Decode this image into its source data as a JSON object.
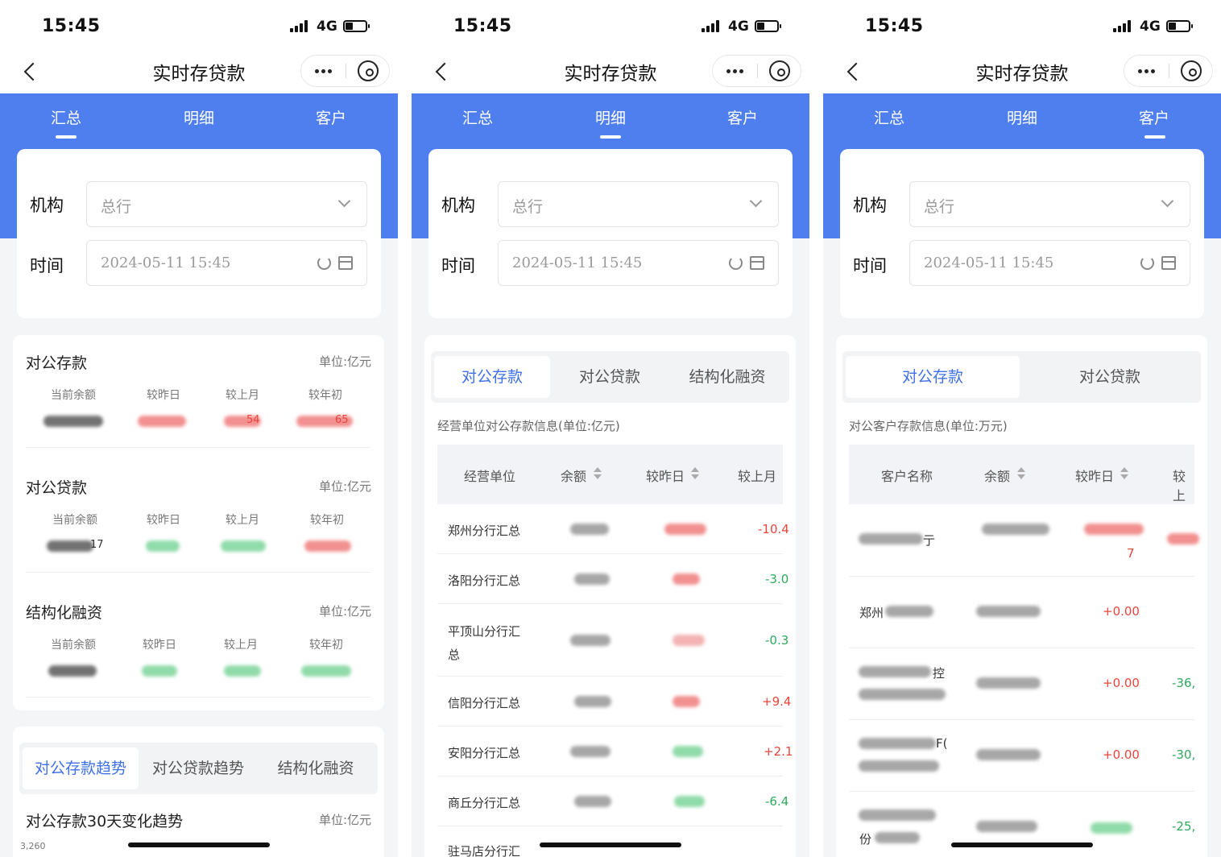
{
  "status": {
    "time": "15:45",
    "network": "4G"
  },
  "nav": {
    "title": "实时存贷款"
  },
  "tabs": [
    "汇总",
    "明细",
    "客户"
  ],
  "filter": {
    "org_label": "机构",
    "org_value": "总行",
    "time_label": "时间",
    "time_value": "2024-05-11 15:45"
  },
  "summary": {
    "unit": "单位:亿元",
    "sections": [
      {
        "title": "对公存款",
        "columns": [
          "当前余额",
          "较昨日",
          "较上月",
          "较年初"
        ],
        "visible_values": [
          "",
          "",
          "54",
          "65"
        ]
      },
      {
        "title": "对公贷款",
        "columns": [
          "当前余额",
          "较昨日",
          "较上月",
          "较年初"
        ],
        "visible_values": [
          "17",
          "",
          "",
          ""
        ]
      },
      {
        "title": "结构化融资",
        "columns": [
          "当前余额",
          "较昨日",
          "较上月",
          "较年初"
        ],
        "visible_values": [
          "",
          "",
          "",
          ""
        ]
      }
    ],
    "trend_tabs": [
      "对公存款趋势",
      "对公贷款趋势",
      "结构化融资"
    ],
    "trend_title": "对公存款30天变化趋势",
    "trend_unit": "单位:亿元",
    "trend_ytick": "3,260"
  },
  "detail": {
    "tabs": [
      "对公存款",
      "对公贷款",
      "结构化融资"
    ],
    "caption": "经营单位对公存款信息(单位:亿元)",
    "headers": [
      "经营单位",
      "余额",
      "较昨日",
      "较上月"
    ],
    "rows": [
      {
        "name": "郑州分行汇总",
        "month": "-10.4"
      },
      {
        "name": "洛阳分行汇总",
        "month": "-3.0"
      },
      {
        "name": "平顶山分行汇总",
        "month": "-0.3"
      },
      {
        "name": "信阳分行汇总",
        "month": "+9.4"
      },
      {
        "name": "安阳分行汇总",
        "month": "+2.1"
      },
      {
        "name": "商丘分行汇总",
        "month": "-6.4"
      },
      {
        "name": "驻马店分行汇",
        "month": ""
      }
    ]
  },
  "customer": {
    "tabs": [
      "对公存款",
      "对公贷款"
    ],
    "caption": "对公客户存款信息(单位:万元)",
    "headers": [
      "客户名称",
      "余额",
      "较昨日",
      "较上"
    ],
    "rows": [
      {
        "name_fragment": "亍",
        "day": "7",
        "month": ""
      },
      {
        "name_fragment": "郑州",
        "day": "+0.00",
        "month": ""
      },
      {
        "name_fragment": "控",
        "day": "+0.00",
        "month": "-36,"
      },
      {
        "name_fragment": "F(",
        "day": "+0.00",
        "month": "-30,"
      },
      {
        "name_fragment": "份",
        "day": "",
        "month": "-25,"
      }
    ]
  },
  "colors": {
    "primary": "#4f7fee",
    "active_text": "#3f70ea",
    "negative_red": "#e8453c"
  }
}
